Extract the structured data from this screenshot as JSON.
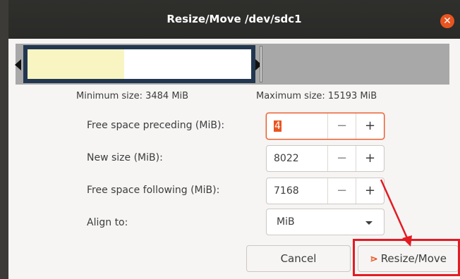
{
  "window": {
    "title": "Resize/Move /dev/sdc1",
    "close_glyph": "✕"
  },
  "sizes": {
    "minimum": "Minimum size: 3484 MiB",
    "maximum": "Maximum size: 15193 MiB"
  },
  "fields": {
    "preceding": {
      "label": "Free space preceding (MiB):",
      "value": "4"
    },
    "new_size": {
      "label": "New size (MiB):",
      "value": "8022"
    },
    "following": {
      "label": "Free space following (MiB):",
      "value": "7168"
    },
    "align": {
      "label": "Align to:",
      "value": "MiB"
    }
  },
  "spin": {
    "minus": "−",
    "plus": "+"
  },
  "buttons": {
    "cancel": "Cancel",
    "resize_move": "Resize/Move",
    "resize_icon": "⋗"
  },
  "colors": {
    "accent": "#e95420",
    "annotation": "#e31b23",
    "used_space": "#f8f5c2",
    "partition_border": "#22374f"
  }
}
